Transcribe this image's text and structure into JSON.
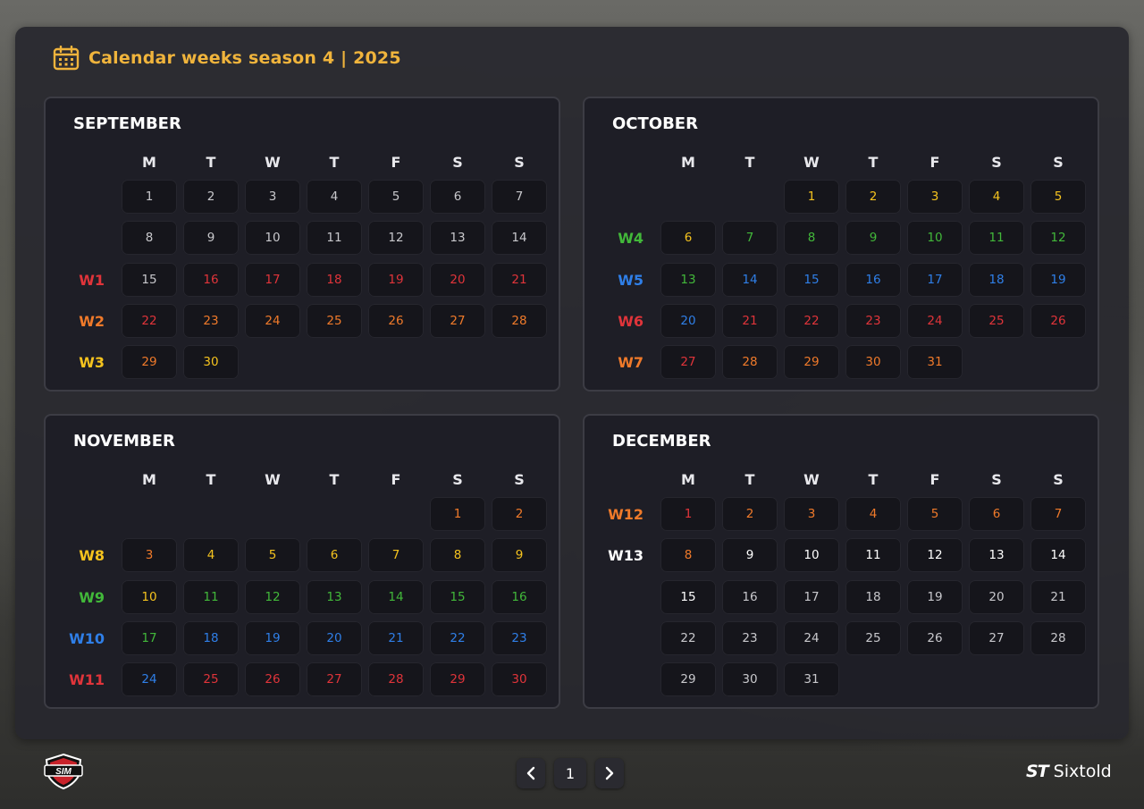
{
  "header": {
    "title": "Calendar weeks season 4 | 2025"
  },
  "weekday_labels": [
    "M",
    "T",
    "W",
    "T",
    "F",
    "S",
    "S"
  ],
  "colors": {
    "red": "#e0343a",
    "orange": "#f07a2a",
    "yellow": "#f5c31e",
    "green": "#42b83a",
    "blue": "#2f7fe8",
    "white": "#ffffff",
    "gray": "#c8c8cc",
    "accent": "#f0b43c"
  },
  "months": [
    {
      "name": "SEPTEMBER",
      "offset": 0,
      "rows": [
        {
          "week": "",
          "color": "gray"
        },
        {
          "week": "",
          "color": "gray"
        },
        {
          "week": "W1",
          "color": "red"
        },
        {
          "week": "W2",
          "color": "orange"
        },
        {
          "week": "W3",
          "color": "yellow"
        }
      ],
      "days": [
        [
          "1",
          "gray"
        ],
        [
          "2",
          "gray"
        ],
        [
          "3",
          "gray"
        ],
        [
          "4",
          "gray"
        ],
        [
          "5",
          "gray"
        ],
        [
          "6",
          "gray"
        ],
        [
          "7",
          "gray"
        ],
        [
          "8",
          "gray"
        ],
        [
          "9",
          "gray"
        ],
        [
          "10",
          "gray"
        ],
        [
          "11",
          "gray"
        ],
        [
          "12",
          "gray"
        ],
        [
          "13",
          "gray"
        ],
        [
          "14",
          "gray"
        ],
        [
          "15",
          "gray"
        ],
        [
          "16",
          "red"
        ],
        [
          "17",
          "red"
        ],
        [
          "18",
          "red"
        ],
        [
          "19",
          "red"
        ],
        [
          "20",
          "red"
        ],
        [
          "21",
          "red"
        ],
        [
          "22",
          "red"
        ],
        [
          "23",
          "orange"
        ],
        [
          "24",
          "orange"
        ],
        [
          "25",
          "orange"
        ],
        [
          "26",
          "orange"
        ],
        [
          "27",
          "orange"
        ],
        [
          "28",
          "orange"
        ],
        [
          "29",
          "orange"
        ],
        [
          "30",
          "yellow"
        ]
      ]
    },
    {
      "name": "OCTOBER",
      "offset": 2,
      "rows": [
        {
          "week": "",
          "color": "gray"
        },
        {
          "week": "W4",
          "color": "green"
        },
        {
          "week": "W5",
          "color": "blue"
        },
        {
          "week": "W6",
          "color": "red"
        },
        {
          "week": "W7",
          "color": "orange"
        }
      ],
      "days": [
        [
          "1",
          "yellow"
        ],
        [
          "2",
          "yellow"
        ],
        [
          "3",
          "yellow"
        ],
        [
          "4",
          "yellow"
        ],
        [
          "5",
          "yellow"
        ],
        [
          "6",
          "yellow"
        ],
        [
          "7",
          "green"
        ],
        [
          "8",
          "green"
        ],
        [
          "9",
          "green"
        ],
        [
          "10",
          "green"
        ],
        [
          "11",
          "green"
        ],
        [
          "12",
          "green"
        ],
        [
          "13",
          "green"
        ],
        [
          "14",
          "blue"
        ],
        [
          "15",
          "blue"
        ],
        [
          "16",
          "blue"
        ],
        [
          "17",
          "blue"
        ],
        [
          "18",
          "blue"
        ],
        [
          "19",
          "blue"
        ],
        [
          "20",
          "blue"
        ],
        [
          "21",
          "red"
        ],
        [
          "22",
          "red"
        ],
        [
          "23",
          "red"
        ],
        [
          "24",
          "red"
        ],
        [
          "25",
          "red"
        ],
        [
          "26",
          "red"
        ],
        [
          "27",
          "red"
        ],
        [
          "28",
          "orange"
        ],
        [
          "29",
          "orange"
        ],
        [
          "30",
          "orange"
        ],
        [
          "31",
          "orange"
        ]
      ]
    },
    {
      "name": "NOVEMBER",
      "offset": 5,
      "rows": [
        {
          "week": "",
          "color": "gray"
        },
        {
          "week": "W8",
          "color": "yellow"
        },
        {
          "week": "W9",
          "color": "green"
        },
        {
          "week": "W10",
          "color": "blue"
        },
        {
          "week": "W11",
          "color": "red"
        }
      ],
      "days": [
        [
          "1",
          "orange"
        ],
        [
          "2",
          "orange"
        ],
        [
          "3",
          "orange"
        ],
        [
          "4",
          "yellow"
        ],
        [
          "5",
          "yellow"
        ],
        [
          "6",
          "yellow"
        ],
        [
          "7",
          "yellow"
        ],
        [
          "8",
          "yellow"
        ],
        [
          "9",
          "yellow"
        ],
        [
          "10",
          "yellow"
        ],
        [
          "11",
          "green"
        ],
        [
          "12",
          "green"
        ],
        [
          "13",
          "green"
        ],
        [
          "14",
          "green"
        ],
        [
          "15",
          "green"
        ],
        [
          "16",
          "green"
        ],
        [
          "17",
          "green"
        ],
        [
          "18",
          "blue"
        ],
        [
          "19",
          "blue"
        ],
        [
          "20",
          "blue"
        ],
        [
          "21",
          "blue"
        ],
        [
          "22",
          "blue"
        ],
        [
          "23",
          "blue"
        ],
        [
          "24",
          "blue"
        ],
        [
          "25",
          "red"
        ],
        [
          "26",
          "red"
        ],
        [
          "27",
          "red"
        ],
        [
          "28",
          "red"
        ],
        [
          "29",
          "red"
        ],
        [
          "30",
          "red"
        ]
      ]
    },
    {
      "name": "DECEMBER",
      "offset": 0,
      "rows": [
        {
          "week": "W12",
          "color": "orange"
        },
        {
          "week": "W13",
          "color": "white"
        },
        {
          "week": "",
          "color": "gray"
        },
        {
          "week": "",
          "color": "gray"
        },
        {
          "week": "",
          "color": "gray"
        }
      ],
      "days": [
        [
          "1",
          "red"
        ],
        [
          "2",
          "orange"
        ],
        [
          "3",
          "orange"
        ],
        [
          "4",
          "orange"
        ],
        [
          "5",
          "orange"
        ],
        [
          "6",
          "orange"
        ],
        [
          "7",
          "orange"
        ],
        [
          "8",
          "orange"
        ],
        [
          "9",
          "white"
        ],
        [
          "10",
          "white"
        ],
        [
          "11",
          "white"
        ],
        [
          "12",
          "white"
        ],
        [
          "13",
          "white"
        ],
        [
          "14",
          "white"
        ],
        [
          "15",
          "white"
        ],
        [
          "16",
          "gray"
        ],
        [
          "17",
          "gray"
        ],
        [
          "18",
          "gray"
        ],
        [
          "19",
          "gray"
        ],
        [
          "20",
          "gray"
        ],
        [
          "21",
          "gray"
        ],
        [
          "22",
          "gray"
        ],
        [
          "23",
          "gray"
        ],
        [
          "24",
          "gray"
        ],
        [
          "25",
          "gray"
        ],
        [
          "26",
          "gray"
        ],
        [
          "27",
          "gray"
        ],
        [
          "28",
          "gray"
        ],
        [
          "29",
          "gray"
        ],
        [
          "30",
          "gray"
        ],
        [
          "31",
          "gray"
        ]
      ]
    }
  ],
  "pagination": {
    "current": "1"
  },
  "footer": {
    "brand_mark": "ST",
    "brand_name": "Sixtold",
    "left_logo": "SIM"
  }
}
